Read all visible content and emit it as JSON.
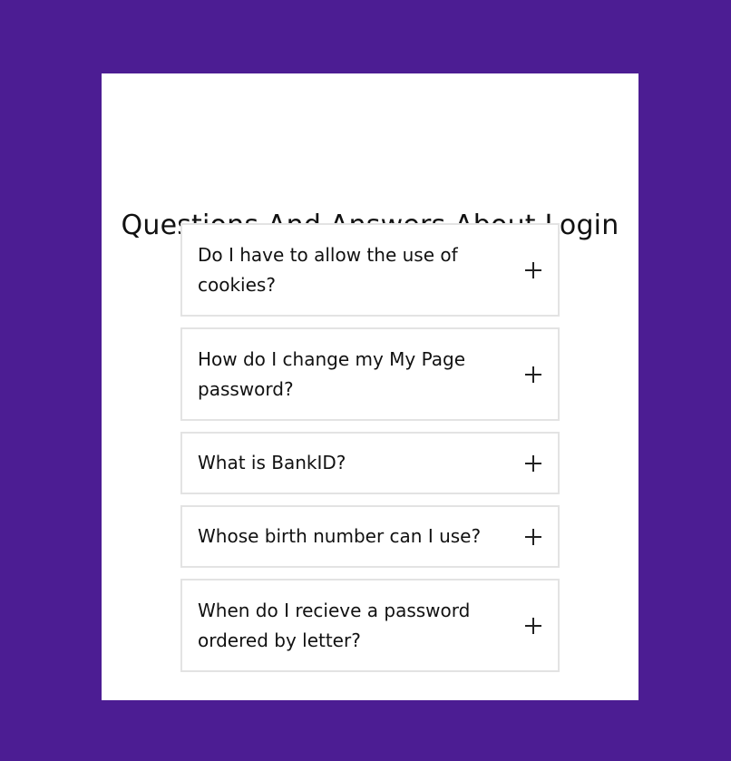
{
  "page": {
    "title": "Questions And Answers About Login",
    "background_color": "#4c1d93"
  },
  "faq": {
    "items": [
      {
        "question": "Do I have to allow the use of cookies?",
        "icon": "plus-icon"
      },
      {
        "question": "How do I change my My Page password?",
        "icon": "plus-icon"
      },
      {
        "question": "What is BankID?",
        "icon": "plus-icon"
      },
      {
        "question": "Whose birth number can I use?",
        "icon": "plus-icon"
      },
      {
        "question": "When do I recieve a password ordered by letter?",
        "icon": "plus-icon"
      }
    ]
  }
}
